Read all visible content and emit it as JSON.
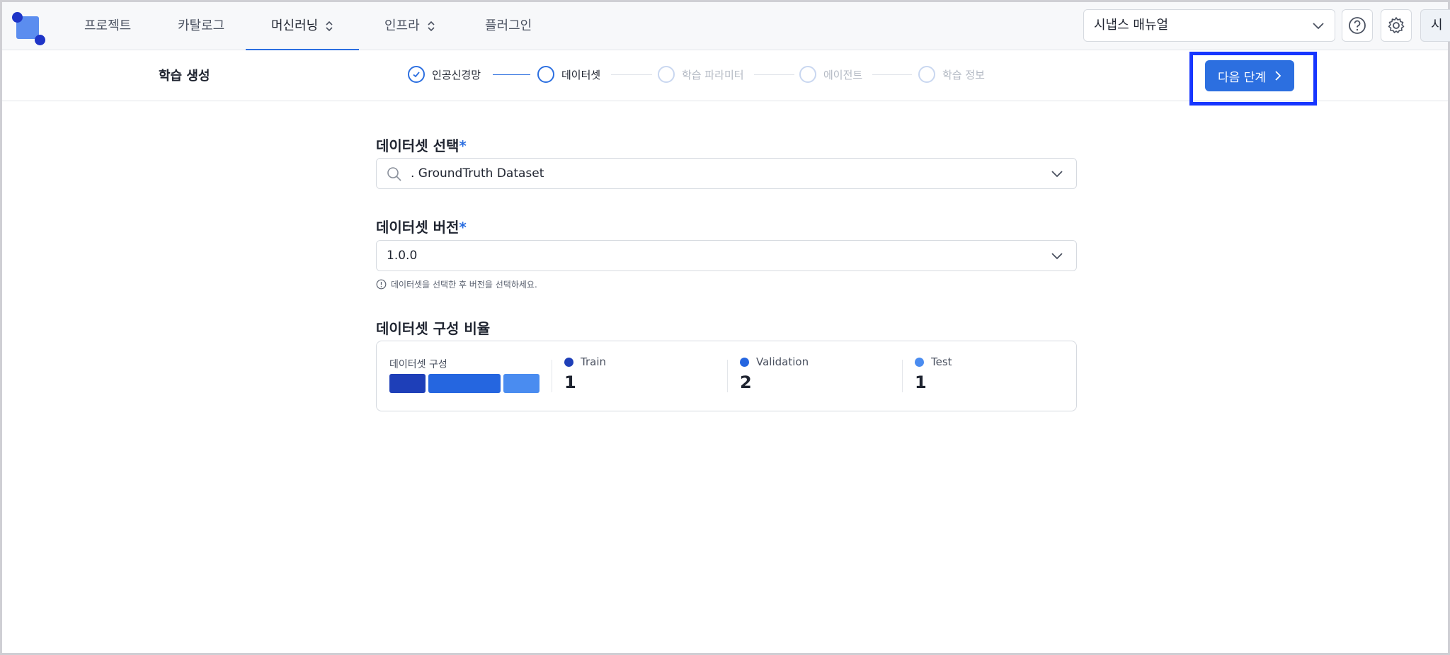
{
  "nav": {
    "items": [
      {
        "label": "프로젝트",
        "has_chevron": false
      },
      {
        "label": "카탈로그",
        "has_chevron": false
      },
      {
        "label": "머신러닝",
        "has_chevron": true,
        "active": true
      },
      {
        "label": "인프라",
        "has_chevron": true
      },
      {
        "label": "플러그인",
        "has_chevron": false
      }
    ],
    "manual_select": "시냅스 매뉴얼",
    "avatar": "시"
  },
  "stepbar": {
    "title": "학습 생성",
    "steps": [
      {
        "label": "인공신경망",
        "state": "done"
      },
      {
        "label": "데이터셋",
        "state": "current"
      },
      {
        "label": "학습 파라미터",
        "state": "pending"
      },
      {
        "label": "에이전트",
        "state": "pending"
      },
      {
        "label": "학습 정보",
        "state": "pending"
      }
    ],
    "next_label": "다음 단계"
  },
  "form": {
    "dataset_title": "데이터셋 선택",
    "dataset_value": ". GroundTruth Dataset",
    "version_title": "데이터셋 버전",
    "version_value": "1.0.0",
    "required_mark": "*",
    "hint": "데이터셋을 선택한 후 버전을 선택하세요.",
    "ratio_title": "데이터셋 구성 비율"
  },
  "ratio": {
    "label": "데이터셋 구성",
    "train": {
      "name": "Train",
      "value": 1,
      "color": "#1e3fb8"
    },
    "validation": {
      "name": "Validation",
      "value": 2,
      "color": "#2566e0"
    },
    "test": {
      "name": "Test",
      "value": 1,
      "color": "#4a8cf0"
    }
  },
  "colors": {
    "accent": "#2c6fe0",
    "highlight": "#1736ff"
  }
}
